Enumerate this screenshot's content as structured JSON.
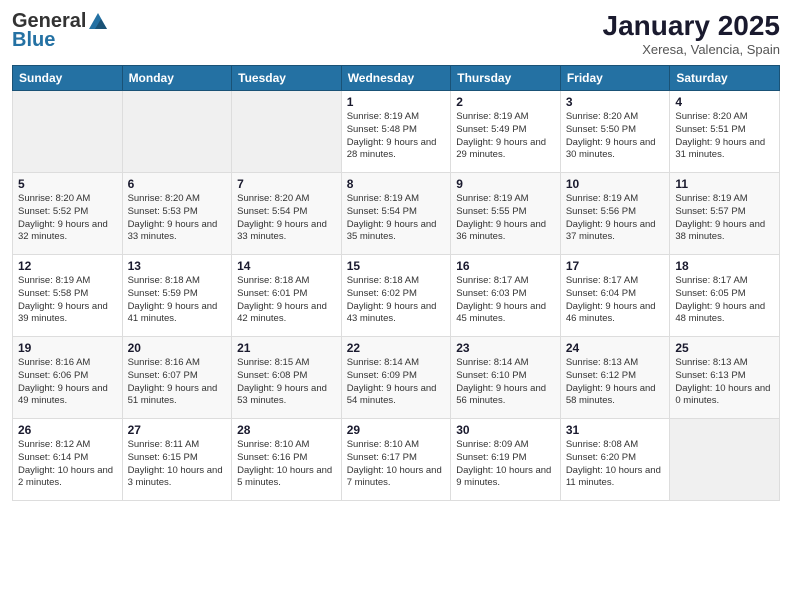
{
  "header": {
    "logo_general": "General",
    "logo_blue": "Blue",
    "title": "January 2025",
    "location": "Xeresa, Valencia, Spain"
  },
  "days_of_week": [
    "Sunday",
    "Monday",
    "Tuesday",
    "Wednesday",
    "Thursday",
    "Friday",
    "Saturday"
  ],
  "weeks": [
    [
      {
        "day": "",
        "info": ""
      },
      {
        "day": "",
        "info": ""
      },
      {
        "day": "",
        "info": ""
      },
      {
        "day": "1",
        "info": "Sunrise: 8:19 AM\nSunset: 5:48 PM\nDaylight: 9 hours\nand 28 minutes."
      },
      {
        "day": "2",
        "info": "Sunrise: 8:19 AM\nSunset: 5:49 PM\nDaylight: 9 hours\nand 29 minutes."
      },
      {
        "day": "3",
        "info": "Sunrise: 8:20 AM\nSunset: 5:50 PM\nDaylight: 9 hours\nand 30 minutes."
      },
      {
        "day": "4",
        "info": "Sunrise: 8:20 AM\nSunset: 5:51 PM\nDaylight: 9 hours\nand 31 minutes."
      }
    ],
    [
      {
        "day": "5",
        "info": "Sunrise: 8:20 AM\nSunset: 5:52 PM\nDaylight: 9 hours\nand 32 minutes."
      },
      {
        "day": "6",
        "info": "Sunrise: 8:20 AM\nSunset: 5:53 PM\nDaylight: 9 hours\nand 33 minutes."
      },
      {
        "day": "7",
        "info": "Sunrise: 8:20 AM\nSunset: 5:54 PM\nDaylight: 9 hours\nand 33 minutes."
      },
      {
        "day": "8",
        "info": "Sunrise: 8:19 AM\nSunset: 5:54 PM\nDaylight: 9 hours\nand 35 minutes."
      },
      {
        "day": "9",
        "info": "Sunrise: 8:19 AM\nSunset: 5:55 PM\nDaylight: 9 hours\nand 36 minutes."
      },
      {
        "day": "10",
        "info": "Sunrise: 8:19 AM\nSunset: 5:56 PM\nDaylight: 9 hours\nand 37 minutes."
      },
      {
        "day": "11",
        "info": "Sunrise: 8:19 AM\nSunset: 5:57 PM\nDaylight: 9 hours\nand 38 minutes."
      }
    ],
    [
      {
        "day": "12",
        "info": "Sunrise: 8:19 AM\nSunset: 5:58 PM\nDaylight: 9 hours\nand 39 minutes."
      },
      {
        "day": "13",
        "info": "Sunrise: 8:18 AM\nSunset: 5:59 PM\nDaylight: 9 hours\nand 41 minutes."
      },
      {
        "day": "14",
        "info": "Sunrise: 8:18 AM\nSunset: 6:01 PM\nDaylight: 9 hours\nand 42 minutes."
      },
      {
        "day": "15",
        "info": "Sunrise: 8:18 AM\nSunset: 6:02 PM\nDaylight: 9 hours\nand 43 minutes."
      },
      {
        "day": "16",
        "info": "Sunrise: 8:17 AM\nSunset: 6:03 PM\nDaylight: 9 hours\nand 45 minutes."
      },
      {
        "day": "17",
        "info": "Sunrise: 8:17 AM\nSunset: 6:04 PM\nDaylight: 9 hours\nand 46 minutes."
      },
      {
        "day": "18",
        "info": "Sunrise: 8:17 AM\nSunset: 6:05 PM\nDaylight: 9 hours\nand 48 minutes."
      }
    ],
    [
      {
        "day": "19",
        "info": "Sunrise: 8:16 AM\nSunset: 6:06 PM\nDaylight: 9 hours\nand 49 minutes."
      },
      {
        "day": "20",
        "info": "Sunrise: 8:16 AM\nSunset: 6:07 PM\nDaylight: 9 hours\nand 51 minutes."
      },
      {
        "day": "21",
        "info": "Sunrise: 8:15 AM\nSunset: 6:08 PM\nDaylight: 9 hours\nand 53 minutes."
      },
      {
        "day": "22",
        "info": "Sunrise: 8:14 AM\nSunset: 6:09 PM\nDaylight: 9 hours\nand 54 minutes."
      },
      {
        "day": "23",
        "info": "Sunrise: 8:14 AM\nSunset: 6:10 PM\nDaylight: 9 hours\nand 56 minutes."
      },
      {
        "day": "24",
        "info": "Sunrise: 8:13 AM\nSunset: 6:12 PM\nDaylight: 9 hours\nand 58 minutes."
      },
      {
        "day": "25",
        "info": "Sunrise: 8:13 AM\nSunset: 6:13 PM\nDaylight: 10 hours\nand 0 minutes."
      }
    ],
    [
      {
        "day": "26",
        "info": "Sunrise: 8:12 AM\nSunset: 6:14 PM\nDaylight: 10 hours\nand 2 minutes."
      },
      {
        "day": "27",
        "info": "Sunrise: 8:11 AM\nSunset: 6:15 PM\nDaylight: 10 hours\nand 3 minutes."
      },
      {
        "day": "28",
        "info": "Sunrise: 8:10 AM\nSunset: 6:16 PM\nDaylight: 10 hours\nand 5 minutes."
      },
      {
        "day": "29",
        "info": "Sunrise: 8:10 AM\nSunset: 6:17 PM\nDaylight: 10 hours\nand 7 minutes."
      },
      {
        "day": "30",
        "info": "Sunrise: 8:09 AM\nSunset: 6:19 PM\nDaylight: 10 hours\nand 9 minutes."
      },
      {
        "day": "31",
        "info": "Sunrise: 8:08 AM\nSunset: 6:20 PM\nDaylight: 10 hours\nand 11 minutes."
      },
      {
        "day": "",
        "info": ""
      }
    ]
  ]
}
